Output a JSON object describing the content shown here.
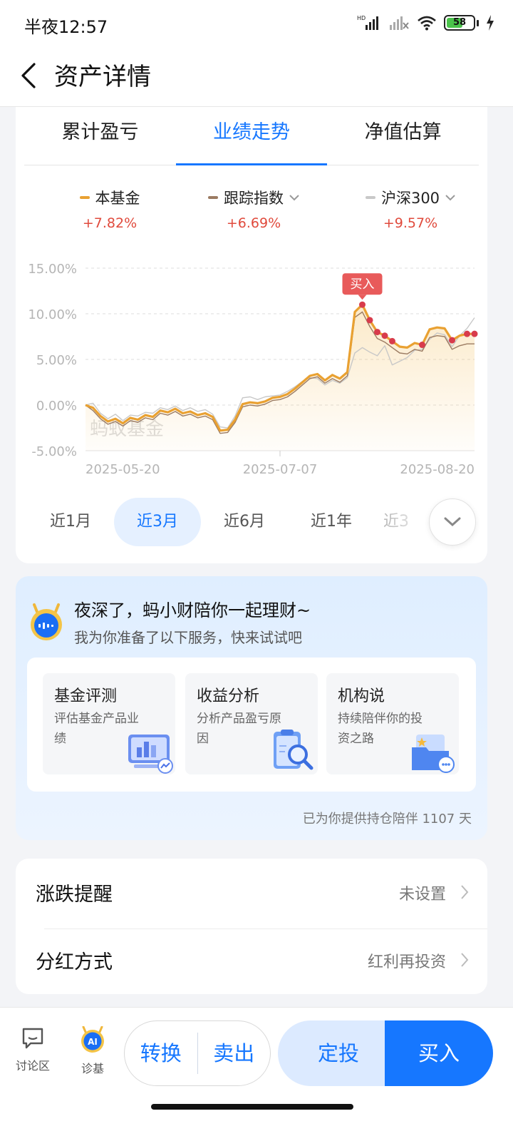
{
  "status_bar": {
    "time": "半夜12:57",
    "battery": "58",
    "icons": [
      "hd-signal-icon",
      "no-signal-icon",
      "wifi-icon",
      "battery-icon",
      "charging-icon"
    ]
  },
  "nav": {
    "title": "资产详情",
    "back_icon": "back-arrow-icon"
  },
  "tabs": [
    {
      "label": "累计盈亏",
      "active": false
    },
    {
      "label": "业绩走势",
      "active": true
    },
    {
      "label": "净值估算",
      "active": false
    }
  ],
  "legend": [
    {
      "name": "本基金",
      "value": "+7.82%",
      "color": "#e9a132",
      "dropdown": false
    },
    {
      "name": "跟踪指数",
      "value": "+6.69%",
      "color": "#9b7b62",
      "dropdown": true
    },
    {
      "name": "沪深300",
      "value": "+9.57%",
      "color": "#c8c8c8",
      "dropdown": true
    }
  ],
  "chart_data": {
    "type": "line",
    "y_ticks": [
      "15.00%",
      "10.00%",
      "5.00%",
      "0.00%",
      "-5.00%"
    ],
    "ylim": [
      -5,
      15
    ],
    "x_ticks": [
      "2025-05-20",
      "2025-07-07",
      "2025-08-20"
    ],
    "watermark": "蚂蚁基金",
    "buy_label": "买入",
    "series": [
      {
        "name": "本基金",
        "color": "#e9a132",
        "values": [
          0.0,
          -0.3,
          -1.2,
          -1.8,
          -1.5,
          -2.0,
          -1.4,
          -1.6,
          -1.1,
          -1.3,
          -0.6,
          -0.8,
          -0.4,
          -0.9,
          -0.7,
          -1.1,
          -0.9,
          -1.3,
          -2.8,
          -2.7,
          -1.6,
          0.1,
          0.3,
          0.2,
          0.4,
          0.8,
          0.9,
          1.2,
          1.8,
          2.5,
          3.2,
          3.4,
          2.7,
          3.3,
          2.9,
          3.6,
          10.2,
          11.0,
          9.3,
          8.0,
          7.6,
          7.0,
          6.4,
          6.3,
          6.8,
          6.6,
          8.3,
          8.5,
          8.4,
          7.1,
          7.6,
          7.8,
          7.8
        ]
      },
      {
        "name": "跟踪指数",
        "color": "#9b7b62",
        "values": [
          0.0,
          -0.6,
          -1.5,
          -2.1,
          -1.8,
          -2.3,
          -1.7,
          -1.9,
          -1.4,
          -1.6,
          -0.9,
          -1.1,
          -0.7,
          -1.2,
          -1.0,
          -1.4,
          -1.2,
          -1.6,
          -3.1,
          -3.0,
          -1.9,
          -0.2,
          0.0,
          -0.1,
          0.1,
          0.5,
          0.6,
          0.9,
          1.5,
          2.2,
          2.9,
          3.1,
          2.4,
          2.9,
          2.5,
          3.2,
          9.6,
          10.2,
          8.6,
          7.3,
          6.9,
          6.3,
          5.7,
          5.6,
          6.1,
          5.9,
          7.4,
          7.6,
          7.5,
          6.1,
          6.5,
          6.7,
          6.7
        ]
      },
      {
        "name": "沪深300",
        "color": "#c8c8c8",
        "values": [
          0.0,
          0.2,
          -0.9,
          -1.5,
          -1.0,
          -1.7,
          -1.1,
          -1.2,
          -0.8,
          -0.9,
          -0.3,
          -0.5,
          -0.1,
          -0.6,
          -0.3,
          -0.7,
          -0.5,
          -1.0,
          -2.4,
          -2.5,
          -1.2,
          0.8,
          0.9,
          0.6,
          0.9,
          1.0,
          1.1,
          1.5,
          2.0,
          2.6,
          3.0,
          2.9,
          2.2,
          2.7,
          2.4,
          3.0,
          5.7,
          6.3,
          5.8,
          5.4,
          6.5,
          4.4,
          4.8,
          5.2,
          6.0,
          6.1,
          7.2,
          7.9,
          7.7,
          6.4,
          7.6,
          8.4,
          9.57
        ]
      }
    ],
    "buy_points": [
      37,
      38,
      39,
      40,
      41,
      45,
      49,
      51,
      52
    ]
  },
  "ranges": [
    {
      "label": "近1月",
      "active": false
    },
    {
      "label": "近3月",
      "active": true
    },
    {
      "label": "近6月",
      "active": false
    },
    {
      "label": "近1年",
      "active": false
    },
    {
      "label": "近3",
      "active": false
    }
  ],
  "assistant": {
    "title": "夜深了，蚂小财陪你一起理财~",
    "subtitle": "我为你准备了以下服务，快来试试吧",
    "services": [
      {
        "title": "基金评测",
        "desc": "评估基金产品业绩",
        "icon": "chart-monitor-icon"
      },
      {
        "title": "收益分析",
        "desc": "分析产品盈亏原因",
        "icon": "clipboard-magnifier-icon"
      },
      {
        "title": "机构说",
        "desc": "持续陪伴你的投资之路",
        "icon": "folder-chat-icon"
      }
    ],
    "accompany": "已为你提供持仓陪伴 1107 天"
  },
  "settings": [
    {
      "label": "涨跌提醒",
      "value": "未设置"
    },
    {
      "label": "分红方式",
      "value": "红利再投资"
    }
  ],
  "bottom": {
    "discuss": "讨论区",
    "diagnose": "诊基",
    "diagnose_badge": "AI",
    "convert": "转换",
    "sell": "卖出",
    "auto_invest": "定投",
    "buy": "买入"
  }
}
